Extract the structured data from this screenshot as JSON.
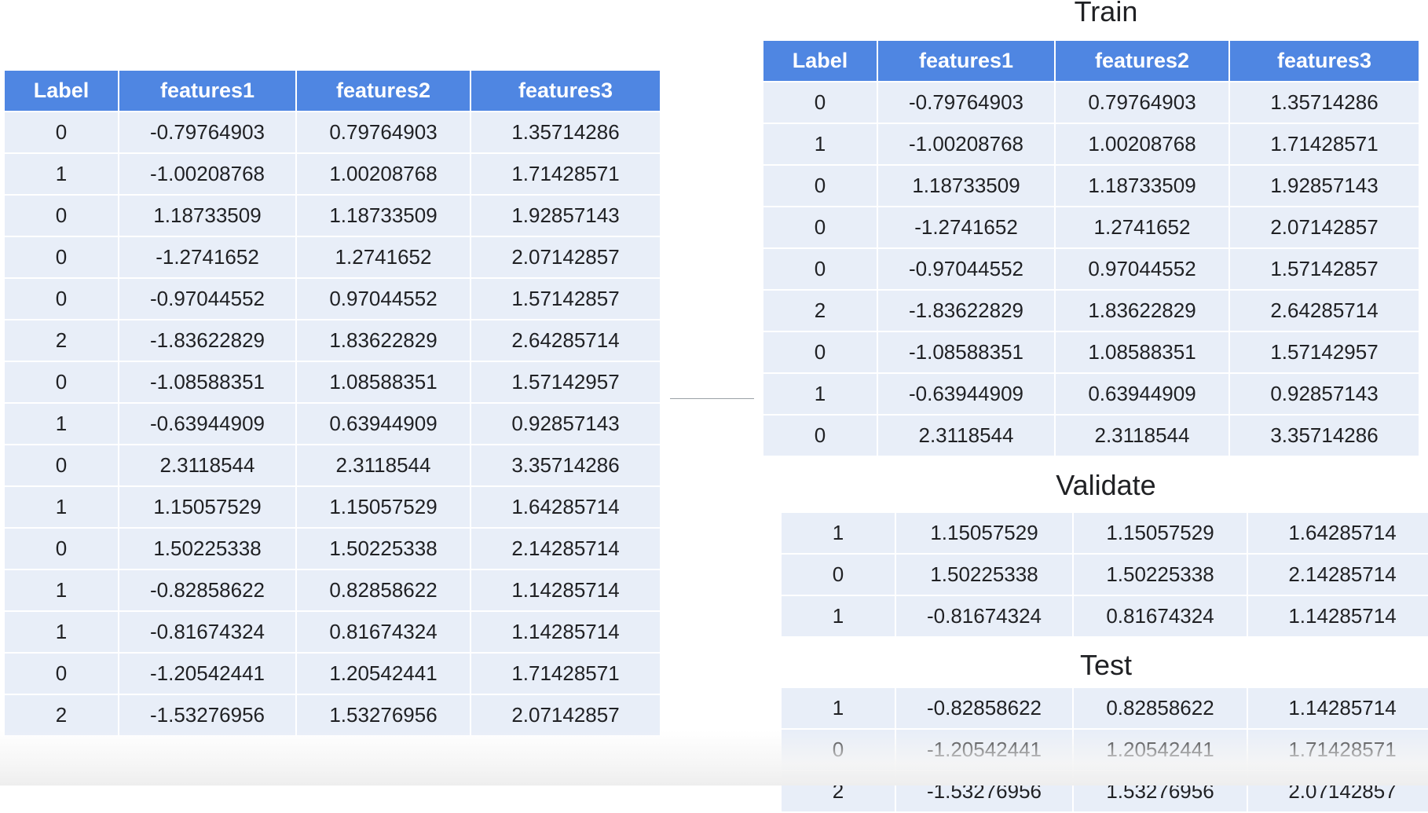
{
  "source_table": {
    "headers": [
      "Label",
      "features1",
      "features2",
      "features3"
    ],
    "rows": [
      [
        "0",
        "-0.79764903",
        "0.79764903",
        "1.35714286"
      ],
      [
        "1",
        "-1.00208768",
        "1.00208768",
        "1.71428571"
      ],
      [
        "0",
        "1.18733509",
        "1.18733509",
        "1.92857143"
      ],
      [
        "0",
        "-1.2741652",
        "1.2741652",
        "2.07142857"
      ],
      [
        "0",
        "-0.97044552",
        "0.97044552",
        "1.57142857"
      ],
      [
        "2",
        "-1.83622829",
        "1.83622829",
        "2.64285714"
      ],
      [
        "0",
        "-1.08588351",
        "1.08588351",
        "1.57142957"
      ],
      [
        "1",
        "-0.63944909",
        "0.63944909",
        "0.92857143"
      ],
      [
        "0",
        "2.3118544",
        "2.3118544",
        "3.35714286"
      ],
      [
        "1",
        "1.15057529",
        "1.15057529",
        "1.64285714"
      ],
      [
        "0",
        "1.50225338",
        "1.50225338",
        "2.14285714"
      ],
      [
        "1",
        "-0.82858622",
        "0.82858622",
        "1.14285714"
      ],
      [
        "1",
        "-0.81674324",
        "0.81674324",
        "1.14285714"
      ],
      [
        "0",
        "-1.20542441",
        "1.20542441",
        "1.71428571"
      ],
      [
        "2",
        "-1.53276956",
        "1.53276956",
        "2.07142857"
      ]
    ]
  },
  "train": {
    "title": "Train",
    "headers": [
      "Label",
      "features1",
      "features2",
      "features3"
    ],
    "rows": [
      [
        "0",
        "-0.79764903",
        "0.79764903",
        "1.35714286"
      ],
      [
        "1",
        "-1.00208768",
        "1.00208768",
        "1.71428571"
      ],
      [
        "0",
        "1.18733509",
        "1.18733509",
        "1.92857143"
      ],
      [
        "0",
        "-1.2741652",
        "1.2741652",
        "2.07142857"
      ],
      [
        "0",
        "-0.97044552",
        "0.97044552",
        "1.57142857"
      ],
      [
        "2",
        "-1.83622829",
        "1.83622829",
        "2.64285714"
      ],
      [
        "0",
        "-1.08588351",
        "1.08588351",
        "1.57142957"
      ],
      [
        "1",
        "-0.63944909",
        "0.63944909",
        "0.92857143"
      ],
      [
        "0",
        "2.3118544",
        "2.3118544",
        "3.35714286"
      ]
    ]
  },
  "validate": {
    "title": "Validate",
    "rows": [
      [
        "1",
        "1.15057529",
        "1.15057529",
        "1.64285714"
      ],
      [
        "0",
        "1.50225338",
        "1.50225338",
        "2.14285714"
      ],
      [
        "1",
        "-0.81674324",
        "0.81674324",
        "1.14285714"
      ]
    ]
  },
  "test": {
    "title": "Test",
    "rows": [
      [
        "1",
        "-0.82858622",
        "0.82858622",
        "1.14285714"
      ],
      [
        "0",
        "-1.20542441",
        "1.20542441",
        "1.71428571"
      ],
      [
        "2",
        "-1.53276956",
        "1.53276956",
        "2.07142857"
      ]
    ]
  },
  "colors": {
    "header_bg": "#4f86e2",
    "cell_bg": "#e8eef8"
  }
}
